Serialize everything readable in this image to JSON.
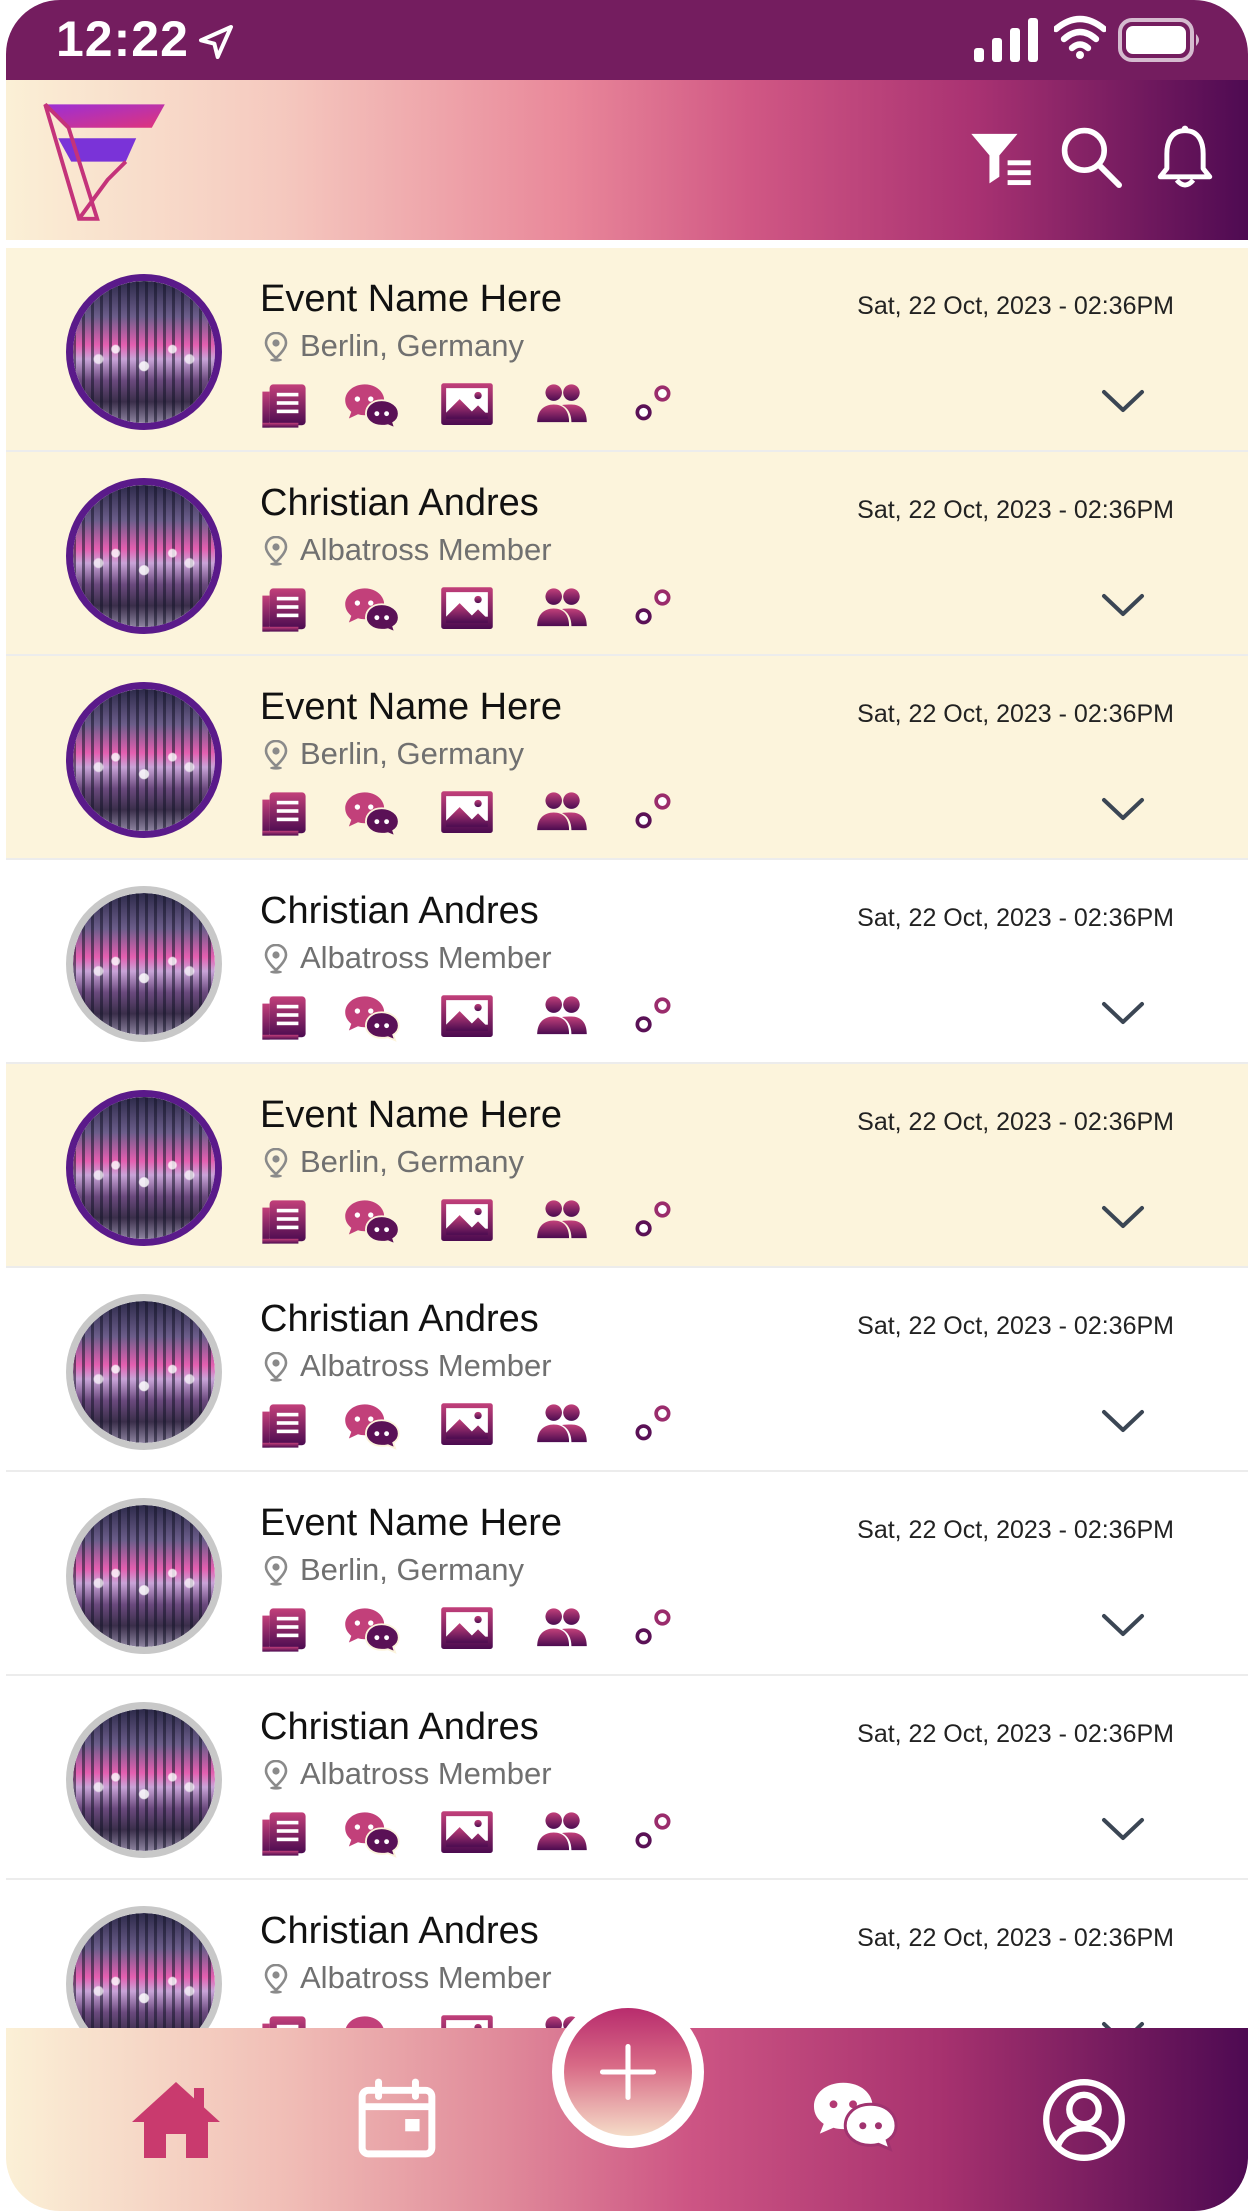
{
  "status_bar": {
    "time": "12:22",
    "icons": [
      "location-arrow-icon",
      "cellular-signal-icon",
      "wifi-icon",
      "battery-icon"
    ]
  },
  "header": {
    "logo_icon": "brand-logo-icon",
    "actions": [
      "filter-funnel-icon",
      "search-icon",
      "bell-icon"
    ]
  },
  "colors": {
    "accent": "#741d5f",
    "highlight_row": "#fcf4dc",
    "icon_gradient_top": "#c2407a",
    "icon_gradient_bottom": "#4b0b50"
  },
  "list": {
    "items": [
      {
        "title": "Event Name Here",
        "subtitle": "Berlin, Germany",
        "date": "Sat, 22 Oct, 2023 - 02:36PM",
        "highlighted": true
      },
      {
        "title": "Christian Andres",
        "subtitle": "Albatross Member",
        "date": "Sat, 22 Oct, 2023 - 02:36PM",
        "highlighted": true
      },
      {
        "title": "Event Name Here",
        "subtitle": "Berlin, Germany",
        "date": "Sat, 22 Oct, 2023 - 02:36PM",
        "highlighted": true
      },
      {
        "title": "Christian Andres",
        "subtitle": "Albatross Member",
        "date": "Sat, 22 Oct, 2023 - 02:36PM",
        "highlighted": false
      },
      {
        "title": "Event Name Here",
        "subtitle": "Berlin, Germany",
        "date": "Sat, 22 Oct, 2023 - 02:36PM",
        "highlighted": true
      },
      {
        "title": "Christian Andres",
        "subtitle": "Albatross Member",
        "date": "Sat, 22 Oct, 2023 - 02:36PM",
        "highlighted": false
      },
      {
        "title": "Event Name Here",
        "subtitle": "Berlin, Germany",
        "date": "Sat, 22 Oct, 2023 - 02:36PM",
        "highlighted": false
      },
      {
        "title": "Christian Andres",
        "subtitle": "Albatross Member",
        "date": "Sat, 22 Oct, 2023 - 02:36PM",
        "highlighted": false
      },
      {
        "title": "Christian Andres",
        "subtitle": "Albatross Member",
        "date": "Sat, 22 Oct, 2023 - 02:36PM",
        "highlighted": false
      }
    ],
    "row_actions": [
      "document-list-icon",
      "chat-bubbles-icon",
      "image-icon",
      "people-icon",
      "sliders-icon"
    ]
  },
  "fab": {
    "icon": "plus-icon"
  },
  "bottom_nav": {
    "items": [
      "home-icon",
      "calendar-icon",
      "chat-bubbles-icon",
      "profile-icon"
    ]
  }
}
